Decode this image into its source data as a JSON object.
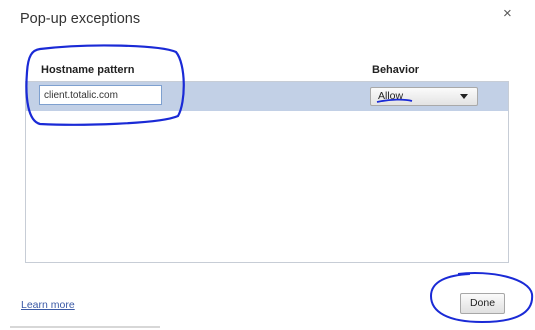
{
  "dialog": {
    "title": "Pop-up exceptions",
    "close_glyph": "×"
  },
  "table": {
    "columns": [
      "Hostname pattern",
      "Behavior"
    ],
    "rows": [
      {
        "hostname": "client.totalic.com",
        "behavior": "Allow"
      }
    ]
  },
  "footer": {
    "learn_more": "Learn more",
    "done_label": "Done"
  },
  "annotation_color": "#1a2ad6"
}
